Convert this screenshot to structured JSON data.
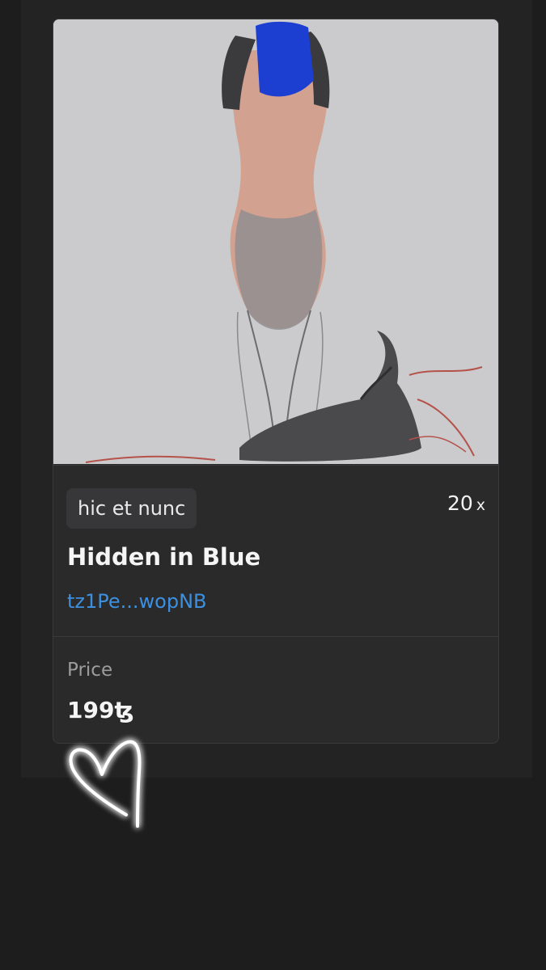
{
  "nft": {
    "platform_badge": "hic et nunc",
    "editions_count": "20",
    "editions_suffix": "x",
    "title": "Hidden in Blue",
    "creator": "tz1Pe...wopNB",
    "price_label": "Price",
    "price_value": "199",
    "currency_symbol": "ꜩ"
  },
  "icons": [
    "heart-icon"
  ],
  "colors": {
    "background": "#1d1d1e",
    "card": "#2a2a2b",
    "link": "#3d8fe0",
    "badge": "#373739",
    "artwork_blue": "#1c3fd1"
  }
}
